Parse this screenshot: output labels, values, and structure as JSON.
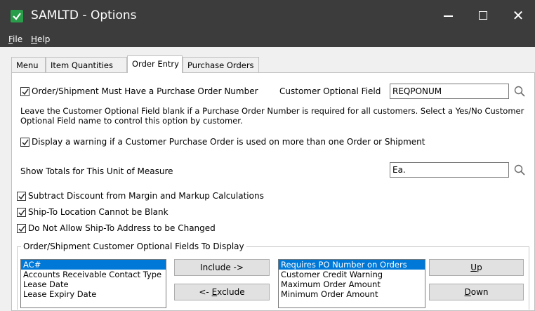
{
  "window": {
    "title": "SAMLTD - Options",
    "controls": {
      "minimize": "—",
      "maximize": "☐",
      "close": "✕"
    }
  },
  "menubar": {
    "file_label_ul": "F",
    "file_label_rest": "ile",
    "help_label_ul": "H",
    "help_label_rest": "elp"
  },
  "tabs": {
    "menu": "Menu",
    "item_quantities": "Item Quantities",
    "order_entry": "Order Entry",
    "purchase_orders": "Purchase Orders",
    "active": "Order Entry"
  },
  "order_entry": {
    "po_required": {
      "label": "Order/Shipment Must Have a Purchase Order Number",
      "checked": true
    },
    "customer_optional_field": {
      "label": "Customer Optional Field",
      "value": "REQPONUM"
    },
    "help_text": "Leave the Customer Optional Field blank if a Purchase Order Number is required for all customers. Select a Yes/No Customer Optional Field name to control this option by customer.",
    "warn_duplicate_po": {
      "label": "Display a warning if a Customer Purchase Order is used on more than one Order or Shipment",
      "checked": true
    },
    "show_totals_uom": {
      "label": "Show Totals for This Unit of Measure",
      "value": "Ea."
    },
    "subtract_discount": {
      "label": "Subtract Discount from Margin and Markup Calculations",
      "checked": true
    },
    "shipto_not_blank": {
      "label": "Ship-To Location Cannot be Blank",
      "checked": true
    },
    "shipto_no_change": {
      "label": "Do Not Allow Ship-To Address to be Changed",
      "checked": true
    },
    "optional_fields_group": {
      "title": "Order/Shipment Customer Optional Fields To Display",
      "available": [
        "AC#",
        "Accounts Receivable Contact Type",
        "Lease Date",
        "Lease Expiry Date"
      ],
      "available_selected": "AC#",
      "displayed": [
        "Requires PO Number on Orders",
        "Customer Credit Warning",
        "Maximum Order Amount",
        "Minimum Order Amount"
      ],
      "displayed_selected": "Requires PO Number on Orders",
      "include_button": "Include ->",
      "exclude_prefix": "<- ",
      "exclude_ul": "E",
      "exclude_rest": "xclude",
      "up_ul": "U",
      "up_rest": "p",
      "down_ul": "D",
      "down_rest": "own"
    }
  },
  "colors": {
    "titlebar": "#3c3c3c",
    "selection": "#0078d7",
    "app_icon": "#2a9d4a"
  }
}
